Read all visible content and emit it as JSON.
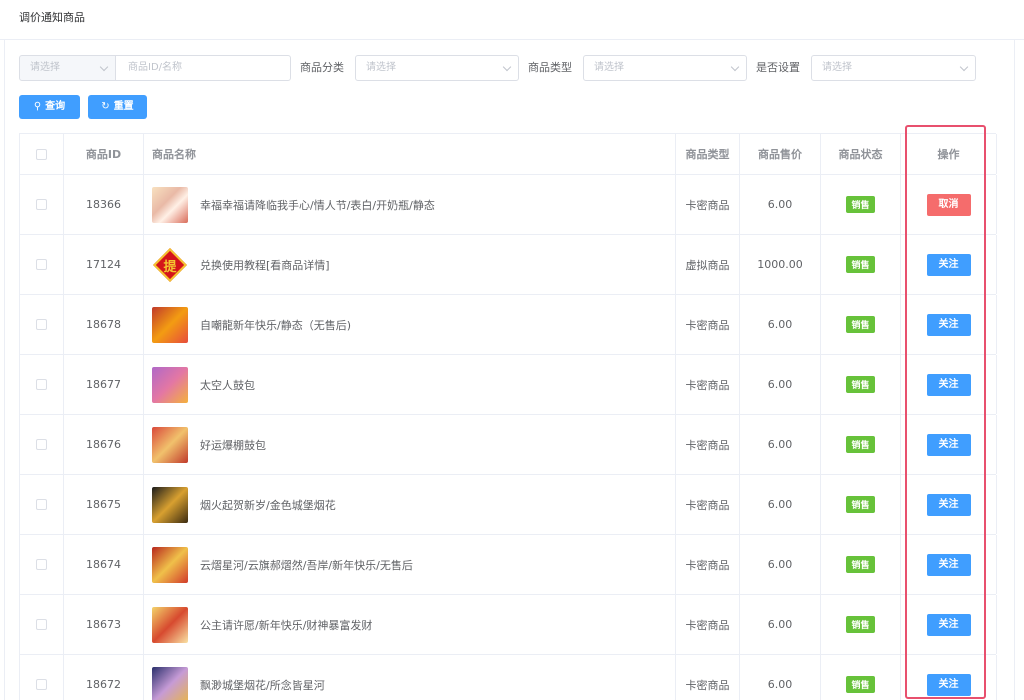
{
  "page": {
    "title": "调价通知商品"
  },
  "filters": {
    "prefix_select": {
      "placeholder": "请选择"
    },
    "name_input": {
      "placeholder": "商品ID/名称"
    },
    "category": {
      "label": "商品分类",
      "placeholder": "请选择"
    },
    "type": {
      "label": "商品类型",
      "placeholder": "请选择"
    },
    "is_set": {
      "label": "是否设置",
      "placeholder": "请选择"
    }
  },
  "actions": {
    "search_label": "查询",
    "reset_label": "重置"
  },
  "table": {
    "headers": {
      "id": "商品ID",
      "name": "商品名称",
      "type": "商品类型",
      "price": "商品售价",
      "status": "商品状态",
      "op": "操作"
    },
    "rows": [
      {
        "id": "18366",
        "name": "幸福幸福请降临我手心/情人节/表白/开奶瓶/静态",
        "type": "卡密商品",
        "price": "6.00",
        "status": "销售",
        "op": "取消",
        "op_kind": "cancel",
        "thumb": "t1"
      },
      {
        "id": "17124",
        "name": "兑换使用教程[看商品详情]",
        "type": "虚拟商品",
        "price": "1000.00",
        "status": "销售",
        "op": "关注",
        "op_kind": "follow",
        "thumb": "t2",
        "thumb_text": "提"
      },
      {
        "id": "18678",
        "name": "自嘲龍新年快乐/静态（无售后)",
        "type": "卡密商品",
        "price": "6.00",
        "status": "销售",
        "op": "关注",
        "op_kind": "follow",
        "thumb": "t3"
      },
      {
        "id": "18677",
        "name": "太空人鼓包",
        "type": "卡密商品",
        "price": "6.00",
        "status": "销售",
        "op": "关注",
        "op_kind": "follow",
        "thumb": "t4"
      },
      {
        "id": "18676",
        "name": "好运爆棚鼓包",
        "type": "卡密商品",
        "price": "6.00",
        "status": "销售",
        "op": "关注",
        "op_kind": "follow",
        "thumb": "t5"
      },
      {
        "id": "18675",
        "name": "烟火起贺新岁/金色城堡烟花",
        "type": "卡密商品",
        "price": "6.00",
        "status": "销售",
        "op": "关注",
        "op_kind": "follow",
        "thumb": "t6"
      },
      {
        "id": "18674",
        "name": "云熠星河/云旗郝熠然/吾岸/新年快乐/无售后",
        "type": "卡密商品",
        "price": "6.00",
        "status": "销售",
        "op": "关注",
        "op_kind": "follow",
        "thumb": "t7"
      },
      {
        "id": "18673",
        "name": "公主请许愿/新年快乐/财神暴富发财",
        "type": "卡密商品",
        "price": "6.00",
        "status": "销售",
        "op": "关注",
        "op_kind": "follow",
        "thumb": "t8"
      },
      {
        "id": "18672",
        "name": "飘渺城堡烟花/所念皆星河",
        "type": "卡密商品",
        "price": "6.00",
        "status": "销售",
        "op": "关注",
        "op_kind": "follow",
        "thumb": "t9"
      }
    ]
  },
  "colors": {
    "primary": "#409eff",
    "danger": "#f56c6c",
    "success": "#67c23a",
    "highlight": "#e8506e"
  }
}
